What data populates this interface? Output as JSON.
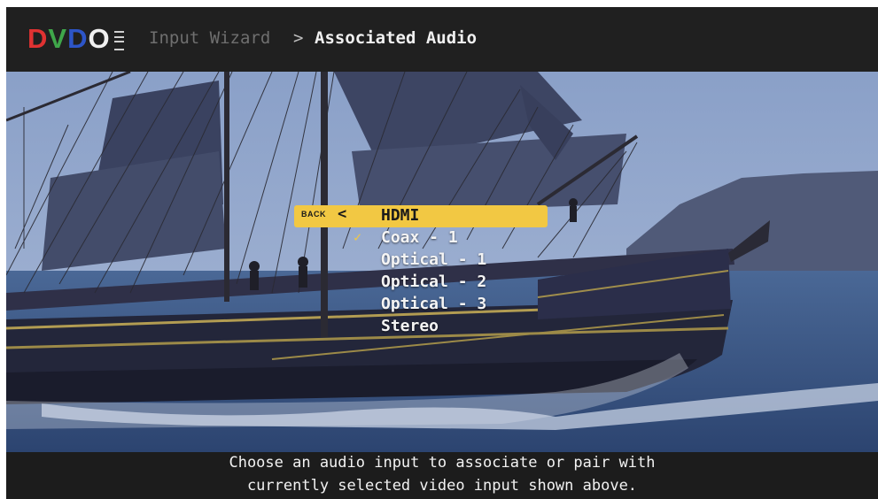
{
  "header": {
    "logo": {
      "letters": [
        {
          "char": "D",
          "color": "#e03232"
        },
        {
          "char": "V",
          "color": "#3fa64a"
        },
        {
          "char": "D",
          "color": "#2d55c8"
        },
        {
          "char": "O",
          "color": "#f0f0f0"
        }
      ]
    },
    "breadcrumb": {
      "parent": "Input Wizard",
      "separator": ">",
      "current": "Associated Audio"
    }
  },
  "menu": {
    "back_label": "BACK",
    "back_icon": "chevron-left-icon",
    "checked_icon": "checkmark-icon",
    "selected_index": 0,
    "checked_index": 1,
    "items": [
      {
        "label": "HDMI"
      },
      {
        "label": "Coax - 1"
      },
      {
        "label": "Optical - 1"
      },
      {
        "label": "Optical - 2"
      },
      {
        "label": "Optical - 3"
      },
      {
        "label": "Stereo"
      }
    ]
  },
  "footer": {
    "line1": "Choose an audio input to associate or pair with",
    "line2": "currently selected video input shown above."
  },
  "colors": {
    "highlight": "#f2c843",
    "bar_background": "#202020"
  }
}
